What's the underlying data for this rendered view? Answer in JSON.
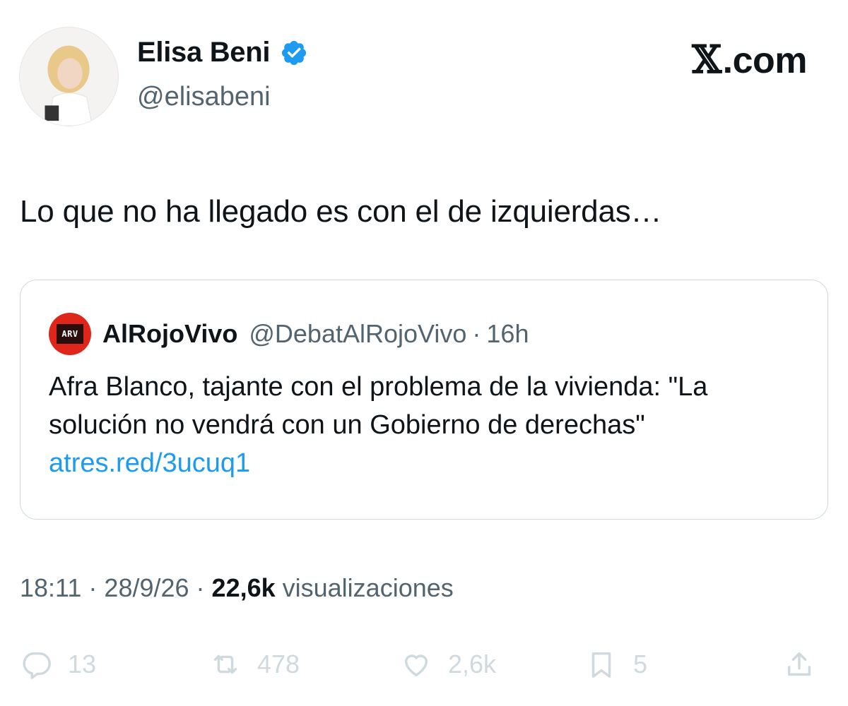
{
  "author": {
    "display_name": "Elisa Beni",
    "handle": "@elisabeni",
    "verified": true
  },
  "brand": {
    "x_glyph": "𝕏",
    "suffix": ".com"
  },
  "tweet": {
    "text": "Lo que no ha llegado es con el de izquierdas…"
  },
  "quoted_tweet": {
    "avatar_text": "ARV",
    "name": "AlRojoVivo",
    "handle": "@DebatAlRojoVivo",
    "separator": "·",
    "time": "16h",
    "text": "Afra Blanco, tajante con el problema de la vivienda: \"La solución no vendrá con un Gobierno de derechas\"",
    "link": "atres.red/3ucuq1"
  },
  "meta": {
    "time": "18:11",
    "separator": "·",
    "date": "28/9/26",
    "views_count": "22,6k",
    "views_label": "visualizaciones"
  },
  "actions": {
    "replies": "13",
    "retweets": "478",
    "likes": "2,6k",
    "bookmarks": "5"
  },
  "colors": {
    "text": "#0f1419",
    "secondary": "#536471",
    "link": "#1d9bf0",
    "verified": "#1d9bf0",
    "border": "#cfd9de",
    "quote_avatar": "#e0261b"
  }
}
